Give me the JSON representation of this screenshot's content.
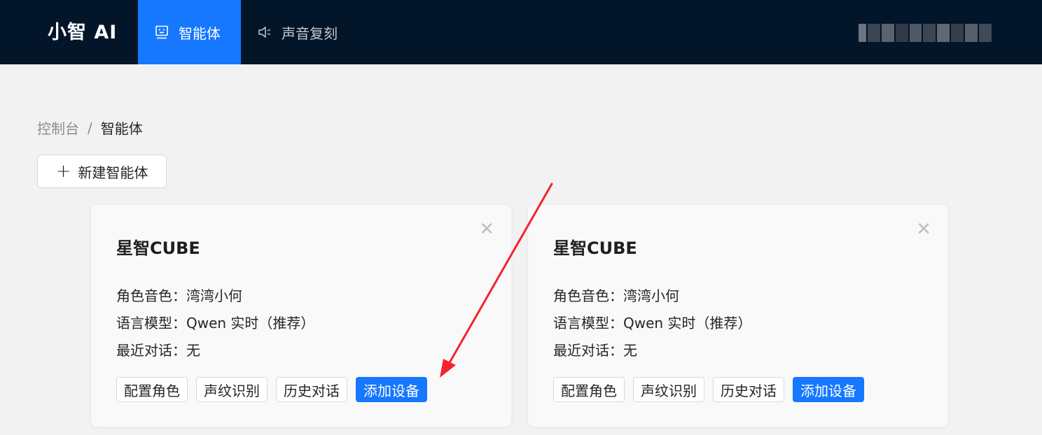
{
  "header": {
    "logo": "小智 AI",
    "nav": [
      {
        "label": "智能体",
        "icon": "robot-icon",
        "active": true
      },
      {
        "label": "声音复刻",
        "icon": "speaker-icon",
        "active": false
      }
    ]
  },
  "breadcrumb": {
    "root": "控制台",
    "separator": "/",
    "current": "智能体"
  },
  "toolbar": {
    "new_agent_label": "新建智能体"
  },
  "agents": [
    {
      "title": "星智CUBE",
      "voice": "角色音色：湾湾小何",
      "model": "语言模型：Qwen 实时（推荐）",
      "last_chat": "最近对话：无",
      "actions": [
        "配置角色",
        "声纹识别",
        "历史对话",
        "添加设备"
      ]
    },
    {
      "title": "星智CUBE",
      "voice": "角色音色：湾湾小何",
      "model": "语言模型：Qwen 实时（推荐）",
      "last_chat": "最近对话：无",
      "actions": [
        "配置角色",
        "声纹识别",
        "历史对话",
        "添加设备"
      ]
    }
  ],
  "colors": {
    "header_bg": "#021529",
    "accent": "#1677ff",
    "annotation_arrow": "#f5222d"
  }
}
